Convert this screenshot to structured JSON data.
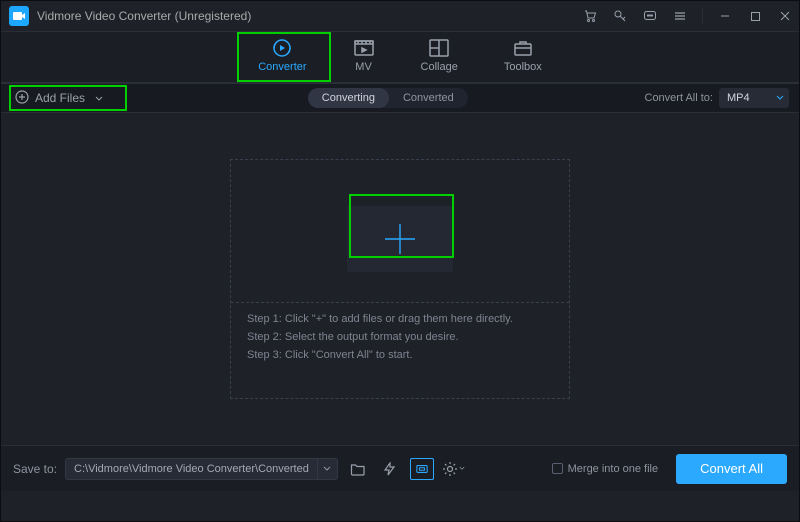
{
  "titlebar": {
    "title": "Vidmore Video Converter (Unregistered)"
  },
  "tabs": {
    "converter": "Converter",
    "mv": "MV",
    "collage": "Collage",
    "toolbox": "Toolbox"
  },
  "subbar": {
    "add_files": "Add Files",
    "pills": {
      "converting": "Converting",
      "converted": "Converted"
    },
    "convert_all_to_label": "Convert All to:",
    "convert_all_to_value": "MP4"
  },
  "drop_zone": {
    "step1": "Step 1: Click \"+\" to add files or drag them here directly.",
    "step2": "Step 2: Select the output format you desire.",
    "step3": "Step 3: Click \"Convert All\" to start."
  },
  "bottom": {
    "save_label": "Save to:",
    "save_path": "C:\\Vidmore\\Vidmore Video Converter\\Converted",
    "merge_label": "Merge into one file",
    "convert_all_button": "Convert All"
  }
}
